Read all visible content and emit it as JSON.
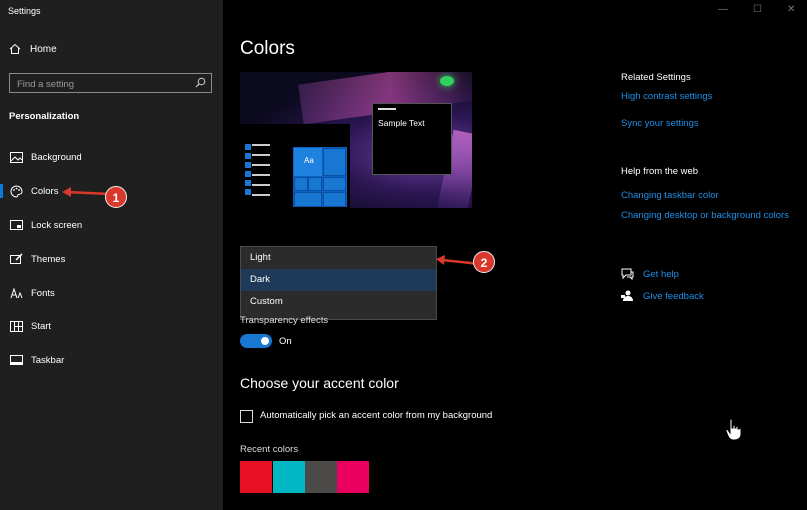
{
  "window": {
    "title": "Settings",
    "controls": {
      "minimize": "—",
      "maximize": "☐",
      "close": "✕"
    }
  },
  "sidebar": {
    "home_label": "Home",
    "search_placeholder": "Find a setting",
    "section_heading": "Personalization",
    "items": [
      {
        "label": "Background",
        "icon": "picture-icon"
      },
      {
        "label": "Colors",
        "icon": "palette-icon",
        "selected": true
      },
      {
        "label": "Lock screen",
        "icon": "lock-screen-icon"
      },
      {
        "label": "Themes",
        "icon": "brush-icon"
      },
      {
        "label": "Fonts",
        "icon": "font-icon"
      },
      {
        "label": "Start",
        "icon": "start-grid-icon"
      },
      {
        "label": "Taskbar",
        "icon": "taskbar-icon"
      }
    ]
  },
  "main": {
    "title": "Colors",
    "preview": {
      "sample_text": "Sample Text",
      "tile_text": "Aa"
    },
    "mode_dropdown": {
      "options": [
        "Light",
        "Dark",
        "Custom"
      ],
      "selected": "Dark"
    },
    "transparency": {
      "label": "Transparency effects",
      "state": "On",
      "on": true
    },
    "accent_heading": "Choose your accent color",
    "auto_accent_label": "Automatically pick an accent color from my background",
    "recent_colors_label": "Recent colors",
    "recent_colors": [
      "#e81123",
      "#00b7c3",
      "#4c4a48",
      "#ea005e"
    ]
  },
  "callouts": [
    "1",
    "2"
  ],
  "related": {
    "heading": "Related Settings",
    "links": [
      "High contrast settings",
      "Sync your settings"
    ]
  },
  "help_web": {
    "heading": "Help from the web",
    "links": [
      "Changing taskbar color",
      "Changing desktop or background colors"
    ]
  },
  "support": {
    "get_help": "Get help",
    "give_feedback": "Give feedback"
  },
  "colors": {
    "accent": "#1877d2",
    "link": "#1f8fe6",
    "callout": "#d9382c"
  }
}
